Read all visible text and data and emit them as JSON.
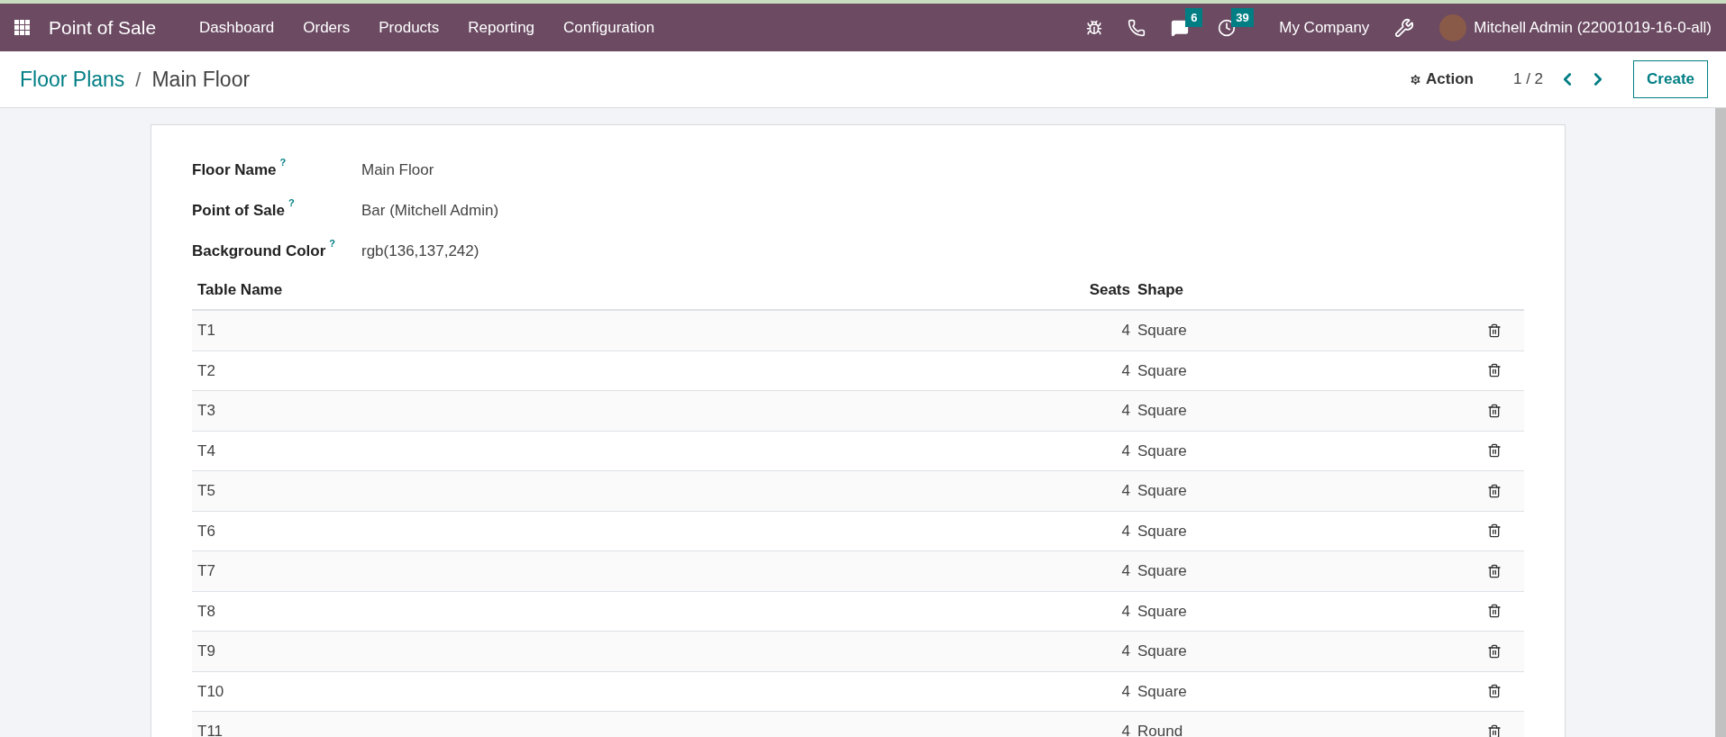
{
  "navbar": {
    "app_name": "Point of Sale",
    "menu": [
      {
        "label": "Dashboard"
      },
      {
        "label": "Orders"
      },
      {
        "label": "Products"
      },
      {
        "label": "Reporting"
      },
      {
        "label": "Configuration"
      }
    ],
    "messages_badge": "6",
    "activities_badge": "39",
    "company": "My Company",
    "user": "Mitchell Admin (22001019-16-0-all)"
  },
  "control_panel": {
    "separator": "/",
    "breadcrumb": [
      {
        "label": "Floor Plans",
        "kind": "link"
      },
      {
        "label": "Main Floor",
        "kind": "current"
      }
    ],
    "action": "Action",
    "pager": "1 / 2",
    "create": "Create"
  },
  "form": {
    "fields": [
      {
        "label": "Floor Name",
        "help": "?",
        "value": "Main Floor"
      },
      {
        "label": "Point of Sale",
        "help": "?",
        "value": "Bar (Mitchell Admin)"
      },
      {
        "label": "Background Color",
        "help": "?",
        "value": "rgb(136,137,242)"
      }
    ],
    "table": {
      "columns": [
        "Table Name",
        "Seats",
        "Shape"
      ],
      "rows": [
        {
          "name": "T1",
          "seats": "4",
          "shape": "Square"
        },
        {
          "name": "T2",
          "seats": "4",
          "shape": "Square"
        },
        {
          "name": "T3",
          "seats": "4",
          "shape": "Square"
        },
        {
          "name": "T4",
          "seats": "4",
          "shape": "Square"
        },
        {
          "name": "T5",
          "seats": "4",
          "shape": "Square"
        },
        {
          "name": "T6",
          "seats": "4",
          "shape": "Square"
        },
        {
          "name": "T7",
          "seats": "4",
          "shape": "Square"
        },
        {
          "name": "T8",
          "seats": "4",
          "shape": "Square"
        },
        {
          "name": "T9",
          "seats": "4",
          "shape": "Square"
        },
        {
          "name": "T10",
          "seats": "4",
          "shape": "Square"
        },
        {
          "name": "T11",
          "seats": "4",
          "shape": "Round"
        }
      ]
    }
  }
}
